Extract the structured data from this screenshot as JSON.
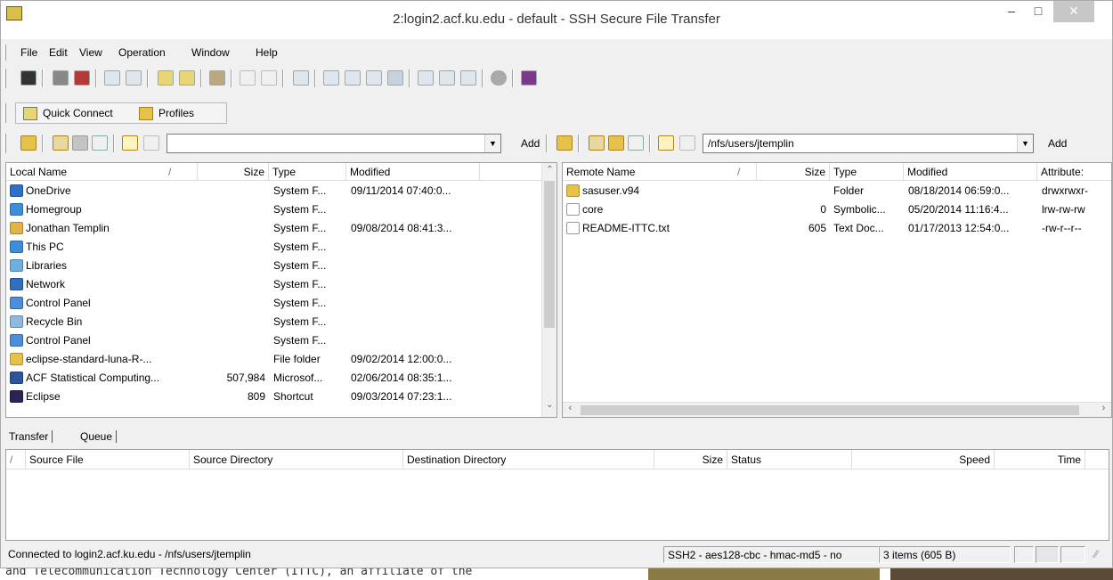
{
  "window": {
    "title": "2:login2.acf.ku.edu - default - SSH Secure File Transfer",
    "min_glyph": "–",
    "max_glyph": "□",
    "close_glyph": "✕"
  },
  "menu": [
    "File",
    "Edit",
    "View",
    "Operation",
    "Window",
    "Help"
  ],
  "quick": {
    "connect_label": "Quick Connect",
    "profiles_label": "Profiles"
  },
  "local": {
    "path_value": "",
    "add_label": "Add",
    "columns": [
      "Local Name",
      "Size",
      "Type",
      "Modified"
    ],
    "rows": [
      {
        "name": "OneDrive",
        "size": "",
        "type": "System F...",
        "modified": "09/11/2014 07:40:0...",
        "icon": "cloud-icon"
      },
      {
        "name": "Homegroup",
        "size": "",
        "type": "System F...",
        "modified": "",
        "icon": "homegroup-icon"
      },
      {
        "name": "Jonathan Templin",
        "size": "",
        "type": "System F...",
        "modified": "09/08/2014 08:41:3...",
        "icon": "user-folder-icon"
      },
      {
        "name": "This PC",
        "size": "",
        "type": "System F...",
        "modified": "",
        "icon": "computer-icon"
      },
      {
        "name": "Libraries",
        "size": "",
        "type": "System F...",
        "modified": "",
        "icon": "libraries-icon"
      },
      {
        "name": "Network",
        "size": "",
        "type": "System F...",
        "modified": "",
        "icon": "network-icon"
      },
      {
        "name": "Control Panel",
        "size": "",
        "type": "System F...",
        "modified": "",
        "icon": "control-panel-icon"
      },
      {
        "name": "Recycle Bin",
        "size": "",
        "type": "System F...",
        "modified": "",
        "icon": "recycle-bin-icon"
      },
      {
        "name": "Control Panel",
        "size": "",
        "type": "System F...",
        "modified": "",
        "icon": "control-panel-icon"
      },
      {
        "name": "eclipse-standard-luna-R-...",
        "size": "",
        "type": "File folder",
        "modified": "09/02/2014 12:00:0...",
        "icon": "folder-icon"
      },
      {
        "name": "ACF Statistical Computing...",
        "size": "507,984",
        "type": "Microsof...",
        "modified": "02/06/2014 08:35:1...",
        "icon": "word-doc-icon"
      },
      {
        "name": "Eclipse",
        "size": "809",
        "type": "Shortcut",
        "modified": "09/03/2014 07:23:1...",
        "icon": "eclipse-icon"
      }
    ]
  },
  "remote": {
    "path_value": "/nfs/users/jtemplin",
    "add_label": "Add",
    "columns": [
      "Remote Name",
      "Size",
      "Type",
      "Modified",
      "Attribute:"
    ],
    "rows": [
      {
        "name": "sasuser.v94",
        "size": "",
        "type": "Folder",
        "modified": "08/18/2014 06:59:0...",
        "attr": "drwxrwxr-",
        "icon": "folder-icon"
      },
      {
        "name": "core",
        "size": "0",
        "type": "Symbolic...",
        "modified": "05/20/2014 11:16:4...",
        "attr": "lrw-rw-rw",
        "icon": "file-icon"
      },
      {
        "name": "README-ITTC.txt",
        "size": "605",
        "type": "Text Doc...",
        "modified": "01/17/2013 12:54:0...",
        "attr": "-rw-r--r--",
        "icon": "text-file-icon"
      }
    ]
  },
  "tabs": [
    "Transfer",
    "Queue"
  ],
  "transfer": {
    "columns": [
      "/",
      "Source File",
      "Source Directory",
      "Destination Directory",
      "Size",
      "Status",
      "Speed",
      "Time"
    ]
  },
  "status": {
    "connection": "Connected to login2.acf.ku.edu - /nfs/users/jtemplin",
    "cipher": "SSH2 - aes128-cbc - hmac-md5 - no",
    "items": "3 items (605 B)"
  },
  "background_text": "and Telecommunication Technology Center (ITTC), an affiliate of the"
}
